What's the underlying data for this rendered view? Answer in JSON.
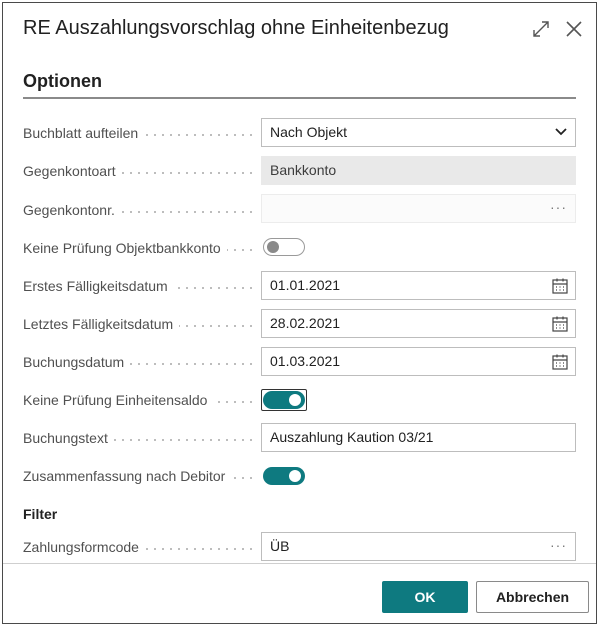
{
  "dialog": {
    "title": "RE Auszahlungsvorschlag ohne Einheitenbezug",
    "expand_icon": "expand-icon",
    "close_icon": "close-icon"
  },
  "section": {
    "title": "Optionen"
  },
  "fields": {
    "buchblatt": {
      "label": "Buchblatt aufteilen",
      "value": "Nach Objekt"
    },
    "gegenkontoart": {
      "label": "Gegenkontoart",
      "value": "Bankkonto"
    },
    "gegenkontonr": {
      "label": "Gegenkontonr.",
      "value": ""
    },
    "keine_pruefung_objektbankkonto": {
      "label": "Keine Prüfung Objektbankkonto",
      "checked": false
    },
    "erstes_faelligkeitsdatum": {
      "label": "Erstes Fälligkeitsdatum",
      "value": "01.01.2021"
    },
    "letztes_faelligkeitsdatum": {
      "label": "Letztes Fälligkeitsdatum",
      "value": "28.02.2021"
    },
    "buchungsdatum": {
      "label": "Buchungsdatum",
      "value": "01.03.2021"
    },
    "keine_pruefung_einheitensaldo": {
      "label": "Keine Prüfung Einheitensaldo",
      "checked": true
    },
    "buchungstext": {
      "label": "Buchungstext",
      "value": "Auszahlung Kaution 03/21"
    },
    "zusammenfassung_debitor": {
      "label": "Zusammenfassung nach Debitor",
      "checked": true
    }
  },
  "filter": {
    "title": "Filter",
    "zahlungsformcode": {
      "label": "Zahlungsformcode",
      "value": "ÜB"
    }
  },
  "buttons": {
    "ok": "OK",
    "cancel": "Abbrechen"
  },
  "colors": {
    "accent": "#0e7a80",
    "readonly_bg": "#e9e9e9"
  }
}
